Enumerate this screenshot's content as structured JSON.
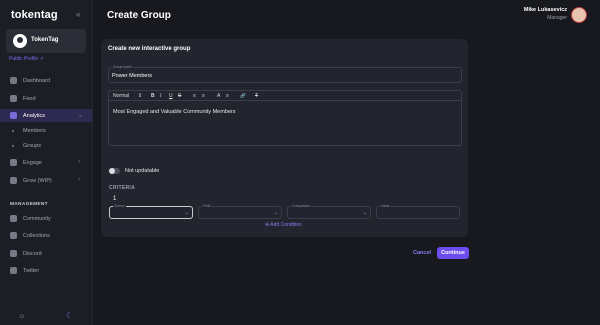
{
  "app": {
    "logo": "tokentag",
    "collapse_glyph": "«"
  },
  "workspace": {
    "name": "TokenTag",
    "link": "Public Profile ↗"
  },
  "nav": [
    {
      "label": "Dashboard",
      "icon": "dashboard-icon"
    },
    {
      "label": "Feed",
      "icon": "feed-icon"
    },
    {
      "label": "Analytics",
      "icon": "analytics-icon",
      "active": true,
      "chevron": "⌄"
    },
    {
      "label": "Engage",
      "icon": "engage-icon",
      "chevron": "›"
    },
    {
      "label": "Grow (WIP)",
      "icon": "grow-icon",
      "chevron": "›"
    }
  ],
  "subnav": [
    "Members",
    "Groups"
  ],
  "management": {
    "title": "MANAGEMENT",
    "items": [
      "Community",
      "Collections",
      "Discord",
      "Twitter"
    ]
  },
  "bottom": {
    "light": "☼",
    "dark": "☾"
  },
  "header": {
    "title": "Create Group"
  },
  "user": {
    "name": "Mike Lukasevicz",
    "role": "Manager"
  },
  "form": {
    "title": "Create new interactive group",
    "name_label": "Group name",
    "name_value": "Power Members",
    "toolbar": {
      "format": "Normal",
      "bold": "B",
      "italic": "I",
      "underline": "U",
      "strike": "S",
      "list_ul": "≡",
      "list_ol": "≡",
      "text_color": "A",
      "align": "≡",
      "link": "🔗",
      "clear": "T"
    },
    "description": "Most Engaged and Valuable Community Members",
    "toggle_label": "Not updatable",
    "criteria_title": "CRITERIA",
    "criteria_number": "1",
    "criteria_fields": [
      "Source",
      "Field",
      "Comparator",
      "Value"
    ],
    "add_condition": "⊕ Add Condition"
  },
  "actions": {
    "cancel": "Cancel",
    "continue": "Continue"
  }
}
